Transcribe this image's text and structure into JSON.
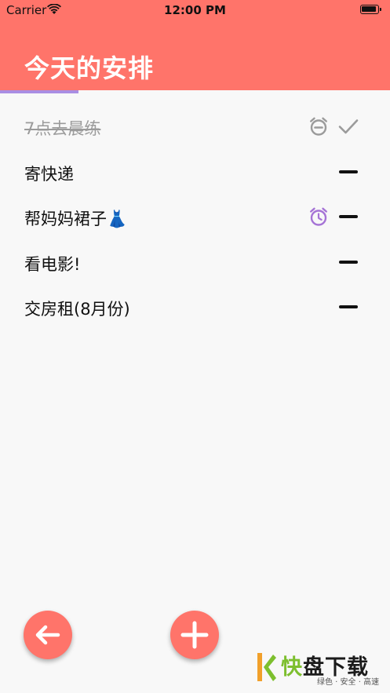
{
  "status_bar": {
    "carrier": "Carrier",
    "time": "12:00 PM",
    "icons": [
      "wifi-icon",
      "battery-icon"
    ]
  },
  "header": {
    "title": "今天的安排",
    "background_color": "#ff746a",
    "tab_indicator_color": "#a98ee3"
  },
  "tasks": [
    {
      "text": "7点去晨练",
      "completed": true,
      "has_alarm": true,
      "alarm_color": "#9b9b9b",
      "action_icon": "check-icon"
    },
    {
      "text": "寄快递",
      "completed": false,
      "has_alarm": false,
      "action_icon": "dash-icon"
    },
    {
      "text": "帮妈妈裙子👗",
      "completed": false,
      "has_alarm": true,
      "alarm_color": "#a674d6",
      "action_icon": "dash-icon"
    },
    {
      "text": "看电影!",
      "completed": false,
      "has_alarm": false,
      "action_icon": "dash-icon"
    },
    {
      "text": "交房租(8月份)",
      "completed": false,
      "has_alarm": false,
      "action_icon": "dash-icon"
    }
  ],
  "fabs": [
    {
      "name": "back-button",
      "icon": "arrow-left-icon",
      "color": "#ff746a"
    },
    {
      "name": "add-task-button",
      "icon": "plus-icon",
      "color": "#ff746a"
    }
  ],
  "watermark": {
    "brand": "快盘下载",
    "tagline": "绿色 · 安全 · 高速"
  }
}
